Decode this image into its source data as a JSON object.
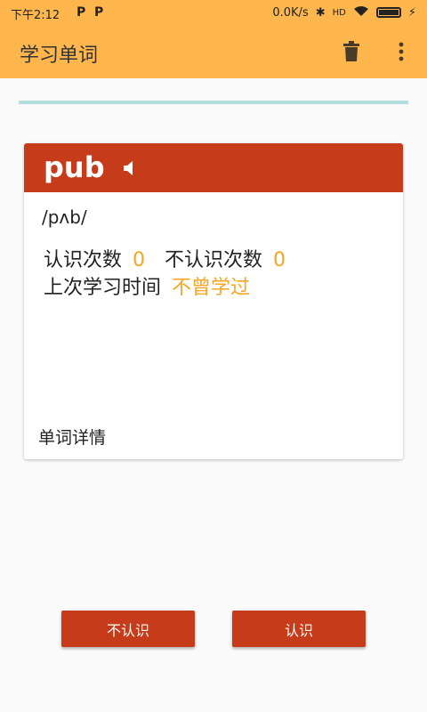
{
  "status_bar": {
    "time": "下午2:12",
    "notif_icons": [
      "P",
      "P"
    ],
    "network_speed": "0.0K/s",
    "icons": [
      "bluetooth-icon",
      "hd-signal-icon",
      "wifi-icon",
      "battery-icon",
      "charging-icon"
    ]
  },
  "app_bar": {
    "title": "学习单词",
    "actions": [
      "trash-icon",
      "more-vert-icon"
    ]
  },
  "card": {
    "word": "pub",
    "phonetic": "/pʌb/",
    "known_label": "认识次数",
    "known_count": "0",
    "unknown_label": "不认识次数",
    "unknown_count": "0",
    "last_study_label": "上次学习时间",
    "last_study_value": "不曾学过",
    "details_link": "单词详情"
  },
  "buttons": {
    "unknown": "不认识",
    "known": "认识"
  },
  "colors": {
    "app_bar": "#ffb74d",
    "card_header": "#c63b19",
    "accent_text": "#f6a623",
    "progress_line": "#b2dfdb",
    "button": "#c63b19"
  }
}
